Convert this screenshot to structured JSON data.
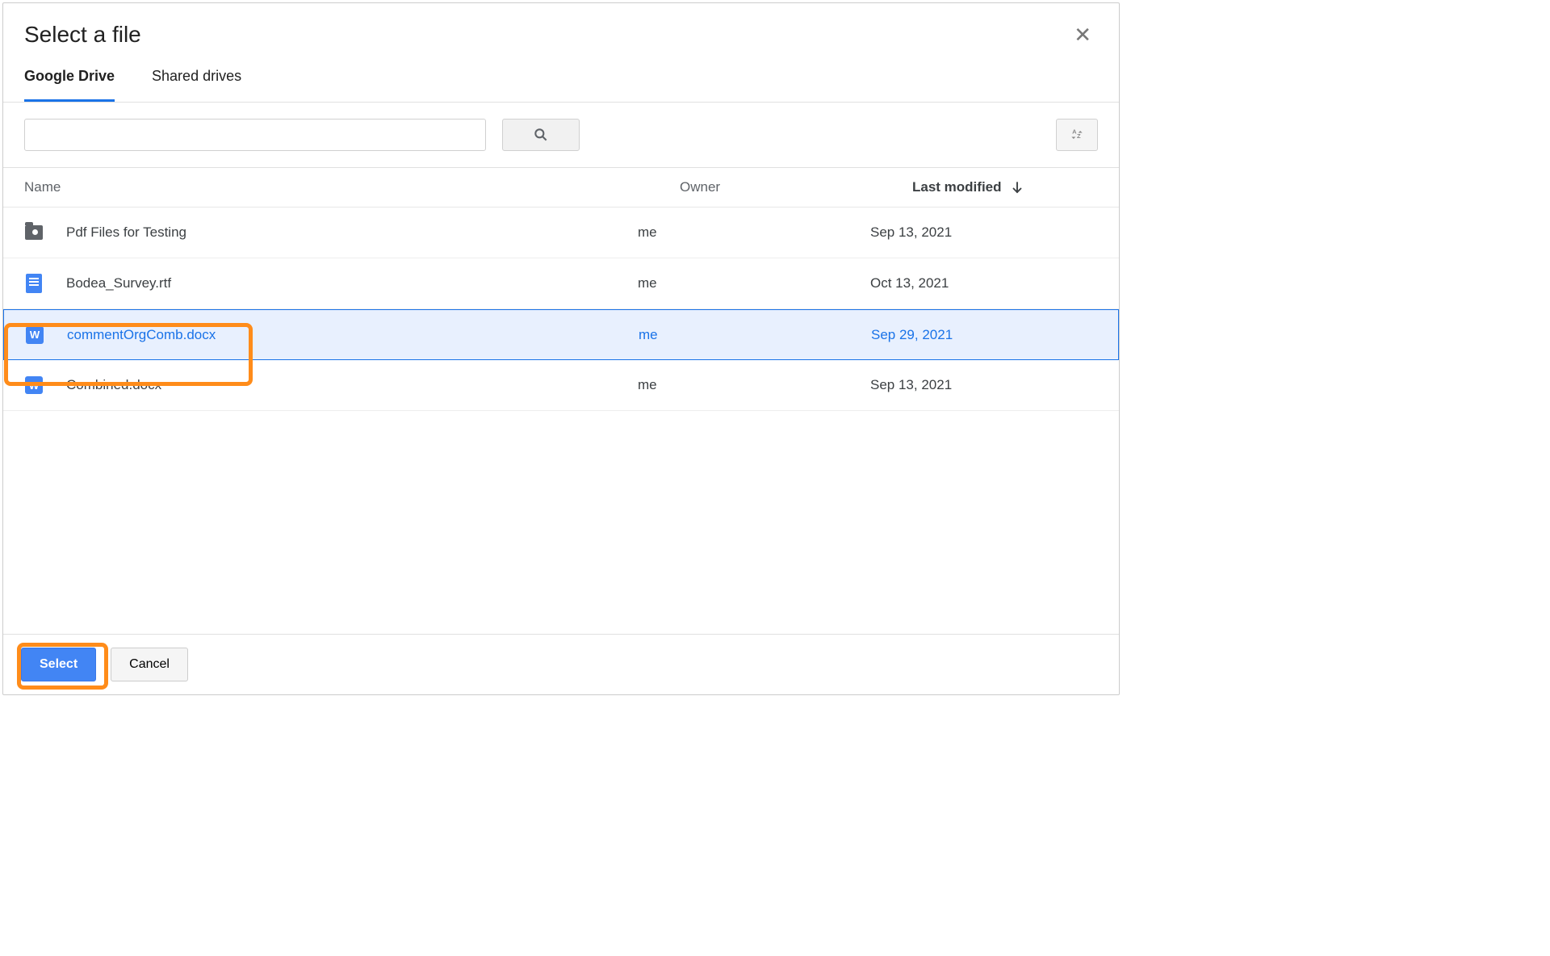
{
  "dialog": {
    "title": "Select a file"
  },
  "tabs": [
    {
      "label": "Google Drive",
      "active": true
    },
    {
      "label": "Shared drives",
      "active": false
    }
  ],
  "columns": {
    "name": "Name",
    "owner": "Owner",
    "modified": "Last modified"
  },
  "files": [
    {
      "icon": "folder-shared",
      "name": "Pdf Files for Testing",
      "owner": "me",
      "modified": "Sep 13, 2021",
      "selected": false
    },
    {
      "icon": "gdoc",
      "name": "Bodea_Survey.rtf",
      "owner": "me",
      "modified": "Oct 13, 2021",
      "selected": false
    },
    {
      "icon": "word",
      "name": "commentOrgComb.docx",
      "owner": "me",
      "modified": "Sep 29, 2021",
      "selected": true
    },
    {
      "icon": "word",
      "name": "Combined.docx",
      "owner": "me",
      "modified": "Sep 13, 2021",
      "selected": false
    }
  ],
  "buttons": {
    "select": "Select",
    "cancel": "Cancel"
  }
}
